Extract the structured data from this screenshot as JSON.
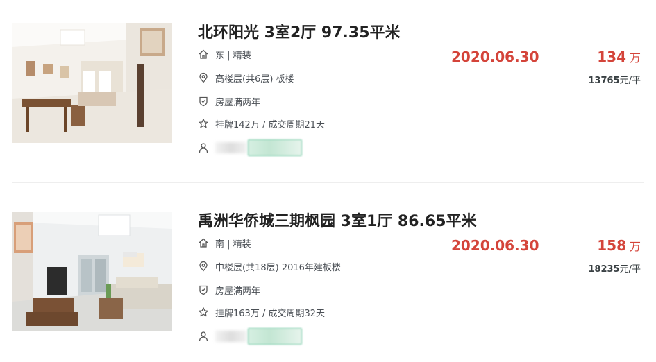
{
  "listings": [
    {
      "title": "北环阳光 3室2厅 97.35平米",
      "orientation_decor": "东 | 精装",
      "floor_info": "高楼层(共6层) 板楼",
      "tax_note": "房屋满两年",
      "listing_info": "挂牌142万 / 成交周期21天",
      "deal_date": "2020.06.30",
      "total_price": "134",
      "price_unit": "万",
      "unit_price_value": "13765",
      "unit_price_suffix": "元/平",
      "image_icon": "room-photo"
    },
    {
      "title": "禹洲华侨城三期枫园 3室1厅 86.65平米",
      "orientation_decor": "南 | 精装",
      "floor_info": "中楼层(共18层) 2016年建板楼",
      "tax_note": "房屋满两年",
      "listing_info": "挂牌163万 / 成交周期32天",
      "deal_date": "2020.06.30",
      "total_price": "158",
      "price_unit": "万",
      "unit_price_value": "18235",
      "unit_price_suffix": "元/平",
      "image_icon": "room-photo"
    }
  ],
  "colors": {
    "accent_red": "#d4443a",
    "agent_green": "#6fc8a2",
    "title_text": "#222222",
    "body_text": "#4a4f55"
  },
  "icons": {
    "orientation": "house-icon",
    "floor": "location-pin-icon",
    "tax": "shield-icon",
    "listing": "star-icon",
    "agent": "user-icon"
  }
}
